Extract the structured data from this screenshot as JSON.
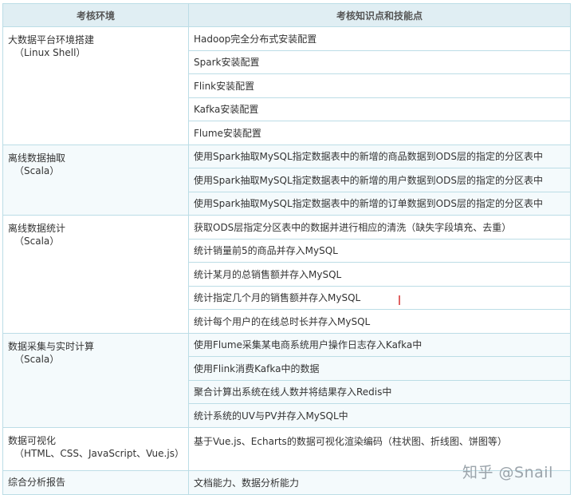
{
  "table": {
    "headers": [
      "考核环境",
      "考核知识点和技能点"
    ],
    "groups": [
      {
        "env": "大数据平台环境搭建",
        "sub": "（Linux Shell）",
        "points": [
          "Hadoop完全分布式安装配置",
          "Spark安装配置",
          "Flink安装配置",
          "Kafka安装配置",
          "Flume安装配置"
        ]
      },
      {
        "env": "离线数据抽取",
        "sub": "（Scala）",
        "points": [
          "使用Spark抽取MySQL指定数据表中的新增的商品数据到ODS层的指定的分区表中",
          "使用Spark抽取MySQL指定数据表中的新增的用户数据到ODS层的指定的分区表中",
          "使用Spark抽取MySQL指定数据表中的新增的订单数据到ODS层的指定的分区表中"
        ]
      },
      {
        "env": "离线数据统计",
        "sub": "（Scala）",
        "points": [
          "获取ODS层指定分区表中的数据并进行相应的清洗（缺失字段填充、去重）",
          "统计销量前5的商品并存入MySQL",
          "统计某月的总销售额并存入MySQL",
          "统计指定几个月的销售额并存入MySQL",
          "统计每个用户的在线总时长并存入MySQL"
        ]
      },
      {
        "env": "数据采集与实时计算",
        "sub": "（Scala）",
        "points": [
          "使用Flume采集某电商系统用户操作日志存入Kafka中",
          "使用Flink消费Kafka中的数据",
          "聚合计算出系统在线人数并将结果存入Redis中",
          "统计系统的UV与PV并存入MySQL中"
        ]
      },
      {
        "env": "数据可视化",
        "sub": "（HTML、CSS、JavaScript、Vue.js）",
        "points": [
          "基于Vue.js、Echarts的数据可视化渲染编码（柱状图、折线图、饼图等）"
        ]
      },
      {
        "env": "综合分析报告",
        "sub": "",
        "points": [
          "文档能力、数据分析能力"
        ]
      }
    ]
  },
  "watermark": "知乎 @Snail"
}
